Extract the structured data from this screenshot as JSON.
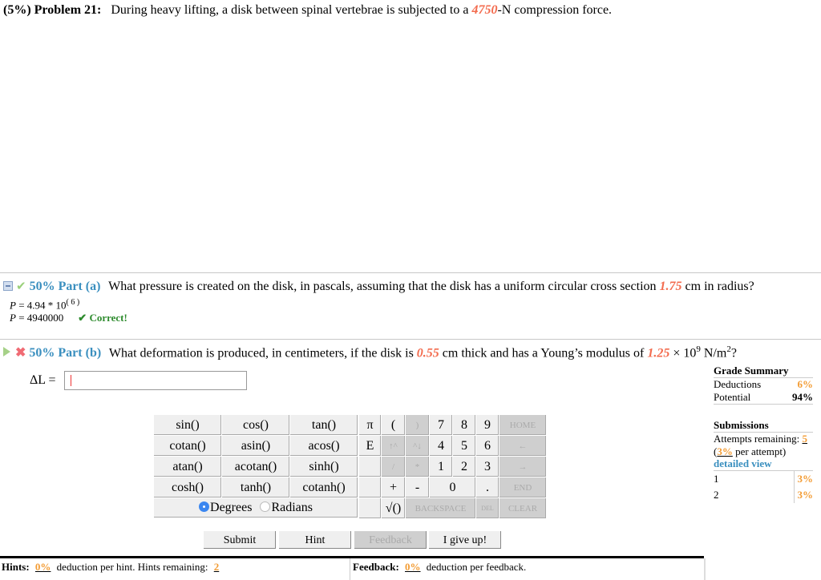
{
  "problem": {
    "weight": "(5%)",
    "title": "Problem 21:",
    "text_before": "During heavy lifting, a disk between spinal vertebrae is subjected to a ",
    "force_value": "4750",
    "text_after": "-N compression force."
  },
  "part_a": {
    "percent_label": "50% Part (a)",
    "question_before": "What pressure is created on the disk, in pascals, assuming that the disk has a uniform circular cross section ",
    "radius_value": "1.75",
    "question_after": " cm in radius?",
    "answer_var": "P",
    "answer_expr": " = 4.94 * 10",
    "answer_exp": "( 6 )",
    "answer_numeric": " = 4940000",
    "status": "✔ Correct!"
  },
  "part_b": {
    "percent_label": "50% Part (b)",
    "question_before": "What deformation is produced, in centimeters, if the disk is ",
    "thickness_value": "0.55",
    "question_mid": " cm thick and has a Young’s modulus of ",
    "modulus_value": "1.25",
    "question_after_1": " × 10",
    "question_exp": "9",
    "question_after_2": " N/m",
    "question_exp2": "2",
    "question_after_3": "?",
    "input_label": "ΔL =",
    "input_value": ""
  },
  "calculator": {
    "functions": [
      [
        "sin()",
        "cos()",
        "tan()"
      ],
      [
        "cotan()",
        "asin()",
        "acos()"
      ],
      [
        "atan()",
        "acotan()",
        "sinh()"
      ],
      [
        "cosh()",
        "tanh()",
        "cotanh()"
      ]
    ],
    "angle_modes": {
      "degrees": "Degrees",
      "radians": "Radians",
      "selected": "Degrees"
    },
    "keys": {
      "pi": "π",
      "lparen": "(",
      "rparen": ")",
      "e": "E",
      "up": "↑^",
      "down": "^↓",
      "divide": "/",
      "multiply": "*",
      "plus": "+",
      "minus": "-",
      "sqrt": "√()",
      "d7": "7",
      "d8": "8",
      "d9": "9",
      "d4": "4",
      "d5": "5",
      "d6": "6",
      "d1": "1",
      "d2": "2",
      "d3": "3",
      "d0": "0",
      "dot": ".",
      "home": "HOME",
      "left": "←",
      "right": "→",
      "end": "END",
      "backspace": "BACKSPACE",
      "del": "DEL",
      "clear": "CLEAR"
    }
  },
  "buttons": {
    "submit": "Submit",
    "hint": "Hint",
    "feedback": "Feedback",
    "give_up": "I give up!"
  },
  "grade_summary": {
    "title": "Grade Summary",
    "deductions_label": "Deductions",
    "deductions_value": "6%",
    "potential_label": "Potential",
    "potential_value": "94%"
  },
  "submissions": {
    "title": "Submissions",
    "attempts_label": "Attempts remaining:",
    "attempts_value": "5",
    "per_attempt_open": "(",
    "per_attempt_value": "3%",
    "per_attempt_close": " per attempt)",
    "detailed_view": "detailed view",
    "rows": [
      {
        "n": "1",
        "value": "3%"
      },
      {
        "n": "2",
        "value": "3%"
      }
    ]
  },
  "footer": {
    "hints_label": "Hints:",
    "hints_pct": "0%",
    "hints_text": "deduction per hint. Hints remaining:",
    "hints_remaining": "2",
    "feedback_label": "Feedback:",
    "feedback_pct": "0%",
    "feedback_text": "deduction per feedback."
  }
}
